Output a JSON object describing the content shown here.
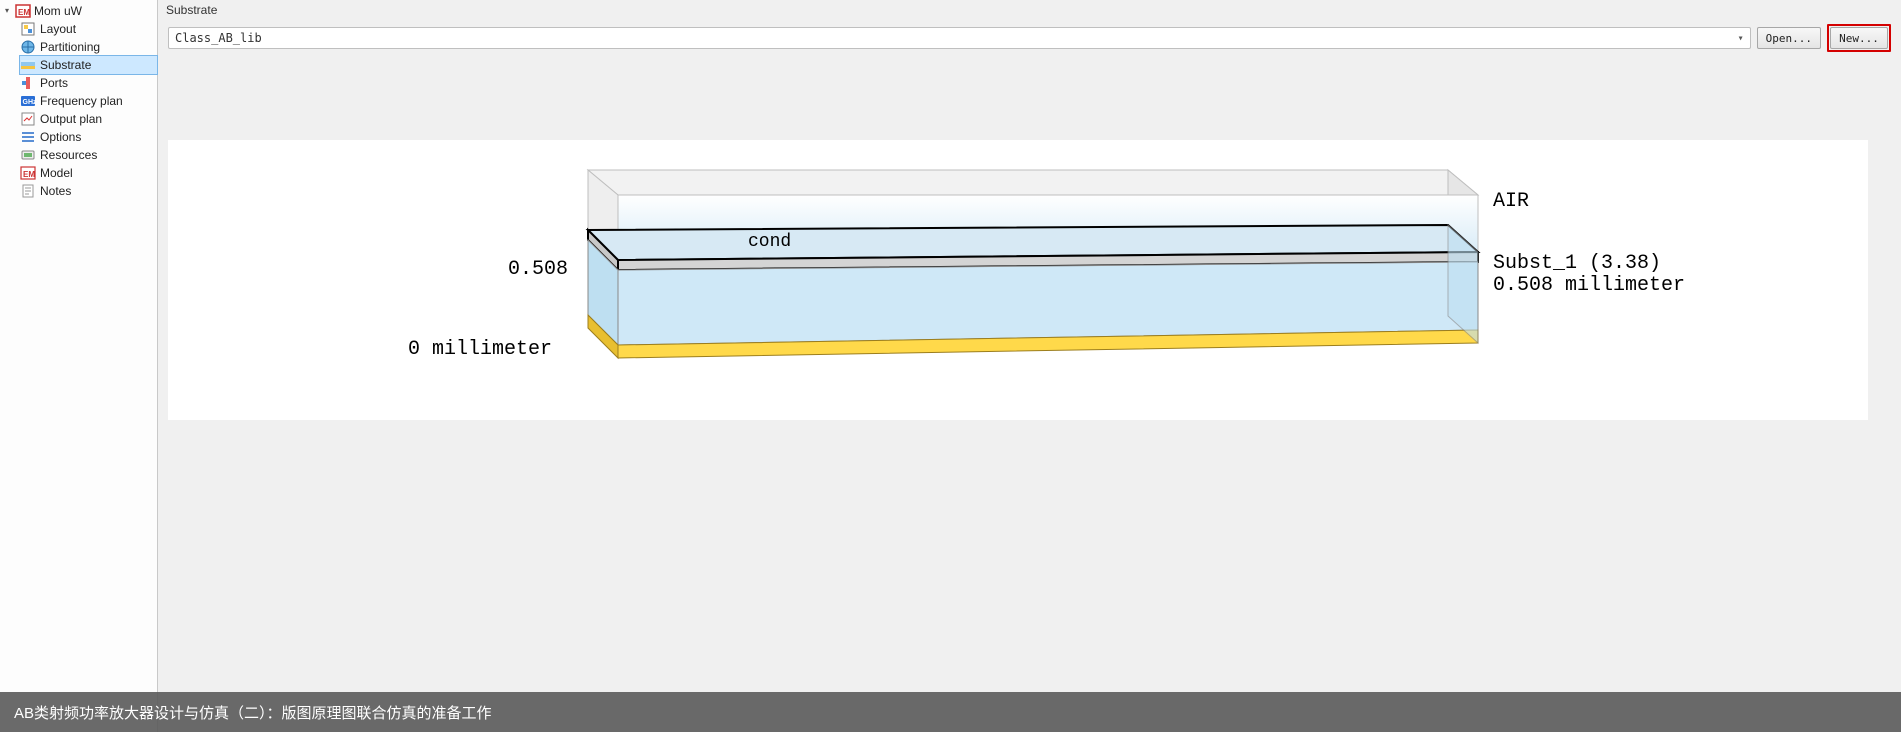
{
  "sidebar": {
    "root": "Mom uW",
    "items": [
      {
        "label": "Layout"
      },
      {
        "label": "Partitioning"
      },
      {
        "label": "Substrate"
      },
      {
        "label": "Ports"
      },
      {
        "label": "Frequency plan"
      },
      {
        "label": "Output plan"
      },
      {
        "label": "Options"
      },
      {
        "label": "Resources"
      },
      {
        "label": "Model"
      },
      {
        "label": "Notes"
      }
    ],
    "selected_index": 2
  },
  "panel": {
    "title": "Substrate",
    "dropdown_value": "Class_AB_lib",
    "open_label": "Open...",
    "new_label": "New..."
  },
  "diagram": {
    "air_label": "AIR",
    "subst_name_label": "Subst_1 (3.38)",
    "subst_thick_label": "0.508 millimeter",
    "zero_label": "0 millimeter",
    "left_508_label": "0.508",
    "cond_label": "cond"
  },
  "caption": "AB类射频功率放大器设计与仿真（二）：版图原理图联合仿真的准备工作"
}
